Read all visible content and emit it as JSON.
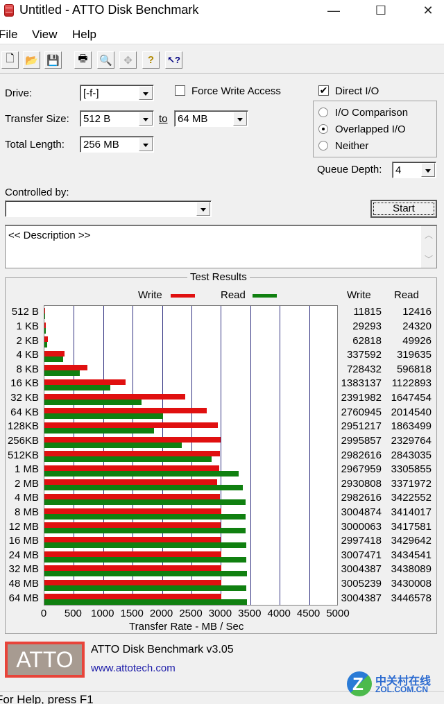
{
  "window": {
    "title": "Untitled - ATTO Disk Benchmark",
    "minimize_icon": "minimize-icon",
    "maximize_icon": "maximize-icon",
    "close_icon": "close-icon",
    "minimize_glyph": "—",
    "maximize_glyph": "☐",
    "close_glyph": "✕"
  },
  "menu": [
    "File",
    "View",
    "Help"
  ],
  "toolbar": [
    {
      "name": "new-document-icon",
      "glyph": "🗋"
    },
    {
      "name": "open-folder-icon",
      "glyph": "📂"
    },
    {
      "name": "save-disk-icon",
      "glyph": "💾"
    },
    {
      "name": "print-icon",
      "glyph": "🖶"
    },
    {
      "name": "print-preview-icon",
      "glyph": "🔍"
    },
    {
      "name": "move-icon",
      "glyph": "✥"
    },
    {
      "name": "help-icon",
      "glyph": "?"
    },
    {
      "name": "context-help-icon",
      "glyph": "↖?"
    }
  ],
  "form": {
    "drive_label": "Drive:",
    "drive_value": "[-f-]",
    "transfer_size_label": "Transfer Size:",
    "transfer_from": "512 B",
    "to_label": "to",
    "transfer_to": "64 MB",
    "total_length_label": "Total Length:",
    "total_length_value": "256 MB",
    "force_write_label": "Force Write Access",
    "force_write_checked": false,
    "direct_io_label": "Direct I/O",
    "direct_io_checked": true,
    "io_options": [
      {
        "label": "I/O Comparison",
        "selected": false
      },
      {
        "label": "Overlapped I/O",
        "selected": true
      },
      {
        "label": "Neither",
        "selected": false
      }
    ],
    "queue_depth_label": "Queue Depth:",
    "queue_depth_value": "4",
    "controlled_by_label": "Controlled by:",
    "controlled_by_value": "",
    "start_label": "Start",
    "description": "<< Description >>"
  },
  "results": {
    "title": "Test Results",
    "legend_write": "Write",
    "legend_read": "Read",
    "col_write": "Write",
    "col_read": "Read",
    "write_color": "#e01010",
    "read_color": "#108010"
  },
  "chart_data": {
    "type": "bar",
    "orientation": "horizontal",
    "title": "Test Results",
    "xlabel": "Transfer Rate - MB / Sec",
    "ylabel": "",
    "xlim": [
      0,
      5000
    ],
    "xticks": [
      "0",
      "500",
      "1000",
      "1500",
      "2000",
      "2500",
      "3000",
      "3500",
      "4000",
      "4500",
      "5000"
    ],
    "grid": true,
    "legend": "top-center",
    "categories": [
      "512 B",
      "1 KB",
      "2 KB",
      "4 KB",
      "8 KB",
      "16 KB",
      "32 KB",
      "64 KB",
      "128KB",
      "256KB",
      "512KB",
      "1 MB",
      "2 MB",
      "4 MB",
      "8 MB",
      "12 MB",
      "16 MB",
      "24 MB",
      "32 MB",
      "48 MB",
      "64 MB"
    ],
    "series": [
      {
        "name": "Write",
        "color": "#e01010",
        "values_kbps": [
          11815,
          29293,
          62818,
          337592,
          728432,
          1383137,
          2391982,
          2760945,
          2951217,
          2995857,
          2982616,
          2967959,
          2930808,
          2982616,
          3004874,
          3000063,
          2997418,
          3007471,
          3004387,
          3005239,
          3004387
        ]
      },
      {
        "name": "Read",
        "color": "#108010",
        "values_kbps": [
          12416,
          24320,
          49926,
          319635,
          596818,
          1122893,
          1647454,
          2014540,
          1863499,
          2329764,
          2843035,
          3305855,
          3371972,
          3422552,
          3414017,
          3417581,
          3429642,
          3434541,
          3438089,
          3430008,
          3446578
        ]
      }
    ]
  },
  "footer": {
    "logo_text": "ATTO",
    "product": "ATTO Disk Benchmark v3.05",
    "website": "www.attotech.com",
    "watermark_cn": "中关村在线",
    "watermark_en": "ZOL.COM.CN",
    "status": "For Help, press F1"
  }
}
